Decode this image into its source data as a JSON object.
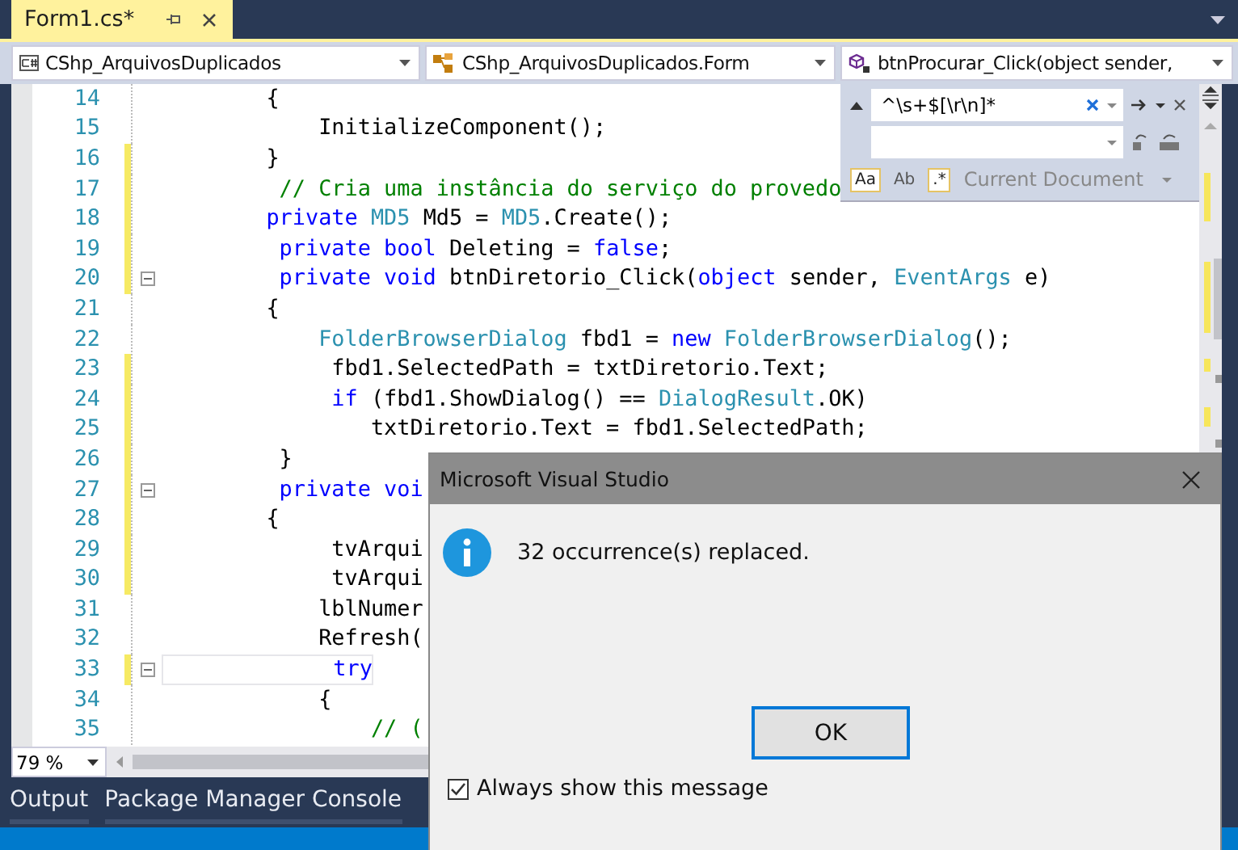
{
  "document_tab": {
    "title": "Form1.cs*"
  },
  "navigation_bar": [
    {
      "kind": "project",
      "text": "CShp_ArquivosDuplicados"
    },
    {
      "kind": "class",
      "text": "CShp_ArquivosDuplicados.Form"
    },
    {
      "kind": "method",
      "text": "btnProcurar_Click(object sender,"
    }
  ],
  "code_lines": [
    {
      "number": "14",
      "changed": false,
      "fold": false,
      "current": false,
      "tokens": [
        {
          "kind": "plain",
          "text": "        {"
        }
      ]
    },
    {
      "number": "15",
      "changed": false,
      "fold": false,
      "current": false,
      "tokens": [
        {
          "kind": "plain",
          "text": "            InitializeComponent();"
        }
      ]
    },
    {
      "number": "16",
      "changed": true,
      "fold": false,
      "current": false,
      "tokens": [
        {
          "kind": "plain",
          "text": "        }"
        }
      ]
    },
    {
      "number": "17",
      "changed": true,
      "fold": false,
      "current": false,
      "tokens": [
        {
          "kind": "comment",
          "text": "         // Cria uma instância do serviço do provedo"
        }
      ]
    },
    {
      "number": "18",
      "changed": true,
      "fold": false,
      "current": false,
      "tokens": [
        {
          "kind": "keyword",
          "text": "        private"
        },
        {
          "kind": "type",
          "text": " MD5"
        },
        {
          "kind": "plain",
          "text": " Md5 = "
        },
        {
          "kind": "type",
          "text": "MD5"
        },
        {
          "kind": "plain",
          "text": ".Create();"
        }
      ]
    },
    {
      "number": "19",
      "changed": true,
      "fold": false,
      "current": false,
      "tokens": [
        {
          "kind": "keyword",
          "text": "         private bool"
        },
        {
          "kind": "plain",
          "text": " Deleting = "
        },
        {
          "kind": "keyword",
          "text": "false"
        },
        {
          "kind": "plain",
          "text": ";"
        }
      ]
    },
    {
      "number": "20",
      "changed": true,
      "fold": true,
      "current": false,
      "tokens": [
        {
          "kind": "keyword",
          "text": "         private void"
        },
        {
          "kind": "plain",
          "text": " btnDiretorio_Click("
        },
        {
          "kind": "keyword",
          "text": "object"
        },
        {
          "kind": "plain",
          "text": " sender, "
        },
        {
          "kind": "type",
          "text": "EventArgs"
        },
        {
          "kind": "plain",
          "text": " e)"
        }
      ]
    },
    {
      "number": "21",
      "changed": false,
      "fold": false,
      "current": false,
      "tokens": [
        {
          "kind": "plain",
          "text": "        {"
        }
      ]
    },
    {
      "number": "22",
      "changed": false,
      "fold": false,
      "current": false,
      "tokens": [
        {
          "kind": "type",
          "text": "            FolderBrowserDialog"
        },
        {
          "kind": "plain",
          "text": " fbd1 = "
        },
        {
          "kind": "keyword",
          "text": "new"
        },
        {
          "kind": "type",
          "text": " FolderBrowserDialog"
        },
        {
          "kind": "plain",
          "text": "();"
        }
      ]
    },
    {
      "number": "23",
      "changed": true,
      "fold": false,
      "current": false,
      "tokens": [
        {
          "kind": "plain",
          "text": "             fbd1.SelectedPath = txtDiretorio.Text;"
        }
      ]
    },
    {
      "number": "24",
      "changed": true,
      "fold": false,
      "current": false,
      "tokens": [
        {
          "kind": "keyword",
          "text": "             if"
        },
        {
          "kind": "plain",
          "text": " (fbd1.ShowDialog() == "
        },
        {
          "kind": "type",
          "text": "DialogResult"
        },
        {
          "kind": "plain",
          "text": ".OK)"
        }
      ]
    },
    {
      "number": "25",
      "changed": true,
      "fold": false,
      "current": false,
      "tokens": [
        {
          "kind": "plain",
          "text": "                txtDiretorio.Text = fbd1.SelectedPath;"
        }
      ]
    },
    {
      "number": "26",
      "changed": true,
      "fold": false,
      "current": false,
      "tokens": [
        {
          "kind": "plain",
          "text": "         }"
        }
      ]
    },
    {
      "number": "27",
      "changed": true,
      "fold": true,
      "current": false,
      "tokens": [
        {
          "kind": "keyword",
          "text": "         private voi"
        }
      ]
    },
    {
      "number": "28",
      "changed": true,
      "fold": false,
      "current": false,
      "tokens": [
        {
          "kind": "plain",
          "text": "        {"
        }
      ]
    },
    {
      "number": "29",
      "changed": true,
      "fold": false,
      "current": false,
      "tokens": [
        {
          "kind": "plain",
          "text": "             tvArqui"
        }
      ]
    },
    {
      "number": "30",
      "changed": true,
      "fold": false,
      "current": false,
      "tokens": [
        {
          "kind": "plain",
          "text": "             tvArqui"
        }
      ]
    },
    {
      "number": "31",
      "changed": false,
      "fold": false,
      "current": false,
      "tokens": [
        {
          "kind": "plain",
          "text": "            lblNumer"
        }
      ]
    },
    {
      "number": "32",
      "changed": false,
      "fold": false,
      "current": false,
      "tokens": [
        {
          "kind": "plain",
          "text": "            Refresh("
        }
      ]
    },
    {
      "number": "33",
      "changed": true,
      "fold": true,
      "current": true,
      "tokens": [
        {
          "kind": "keyword",
          "text": "             try"
        }
      ]
    },
    {
      "number": "34",
      "changed": false,
      "fold": false,
      "current": false,
      "tokens": [
        {
          "kind": "plain",
          "text": "            {"
        }
      ]
    },
    {
      "number": "35",
      "changed": false,
      "fold": false,
      "current": false,
      "tokens": [
        {
          "kind": "comment",
          "text": "                // ("
        }
      ]
    }
  ],
  "find_replace": {
    "find_value": "^\\s+$[\\r\\n]*",
    "options": [
      {
        "label": "Aa",
        "selected": true
      },
      {
        "label": "Ab",
        "selected": false
      },
      {
        "label": ".*",
        "selected": true
      }
    ],
    "scope": "Current Document"
  },
  "zoom": "79 %",
  "panel_tabs": [
    "Output",
    "Package Manager Console"
  ],
  "dialog": {
    "title": "Microsoft Visual Studio",
    "message": "32 occurrence(s) replaced.",
    "button": "OK",
    "checkbox": {
      "label": "Always show this message",
      "checked": true
    }
  }
}
